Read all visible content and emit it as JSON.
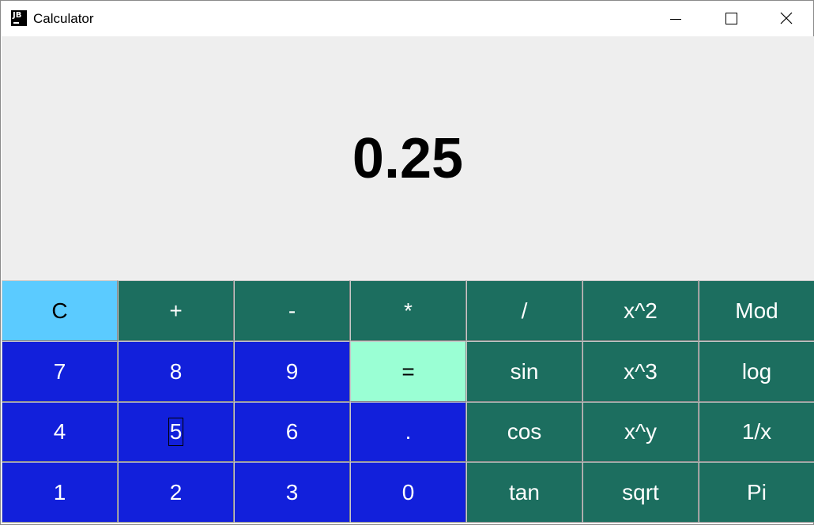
{
  "window": {
    "title": "Calculator",
    "app_icon": "jetbrains-icon",
    "app_icon_text": "JB",
    "controls": [
      "minimize-icon",
      "maximize-icon",
      "close-icon"
    ]
  },
  "display": {
    "value": "0.25"
  },
  "colors": {
    "operator": "#1c6e5f",
    "digit": "#1220db",
    "clear": "#5bcbff",
    "equals": "#9affd4",
    "display_bg": "#eeeeee"
  },
  "keys": {
    "clear": "C",
    "plus": "+",
    "minus": "-",
    "multiply": "*",
    "divide": "/",
    "square": "x^2",
    "mod": "Mod",
    "d7": "7",
    "d8": "8",
    "d9": "9",
    "equals": "=",
    "sin": "sin",
    "cube": "x^3",
    "log": "log",
    "d4": "4",
    "d5": "5",
    "d6": "6",
    "dot": ".",
    "cos": "cos",
    "power": "x^y",
    "reciprocal": "1/x",
    "d1": "1",
    "d2": "2",
    "d3": "3",
    "d0": "0",
    "tan": "tan",
    "sqrt": "sqrt",
    "pi": "Pi"
  },
  "focused_key": "5"
}
